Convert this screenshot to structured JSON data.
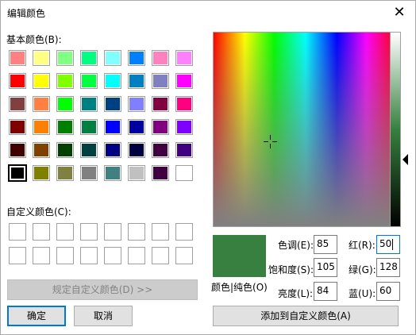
{
  "window": {
    "title": "编辑颜色",
    "close_symbol": "✕"
  },
  "basic_colors": {
    "label": "基本颜色(B):",
    "swatches": [
      "#ff8080",
      "#ffff80",
      "#80ff80",
      "#00ff80",
      "#80ffff",
      "#0080ff",
      "#ff80c0",
      "#ff80ff",
      "#ff0000",
      "#ffff00",
      "#80ff00",
      "#00ff40",
      "#00ffff",
      "#0080c0",
      "#8080c0",
      "#ff00ff",
      "#804040",
      "#ff8040",
      "#00ff00",
      "#008080",
      "#004080",
      "#8080ff",
      "#800040",
      "#ff0080",
      "#800000",
      "#ff8000",
      "#008000",
      "#008040",
      "#0000ff",
      "#0000a0",
      "#800080",
      "#8000ff",
      "#400000",
      "#804000",
      "#004000",
      "#004040",
      "#000080",
      "#000040",
      "#400040",
      "#400080",
      "#000000",
      "#808000",
      "#808040",
      "#808080",
      "#408080",
      "#c0c0c0",
      "#400040",
      "#ffffff"
    ]
  },
  "custom_colors": {
    "label": "自定义颜色(C):"
  },
  "buttons": {
    "define_custom": "规定自定义颜色(D) >>",
    "ok": "确定",
    "cancel": "取消",
    "add_to_custom": "添加到自定义颜色(A)"
  },
  "preview": {
    "label": "颜色|纯色(O)",
    "color": "#378040"
  },
  "fields": {
    "hue_label": "色调(E):",
    "hue": "85",
    "sat_label": "饱和度(S):",
    "sat": "105",
    "lum_label": "亮度(L):",
    "lum": "84",
    "red_label": "红(R):",
    "red": "50",
    "green_label": "绿(G):",
    "green": "128",
    "blue_label": "蓝(U):",
    "blue": "60"
  }
}
